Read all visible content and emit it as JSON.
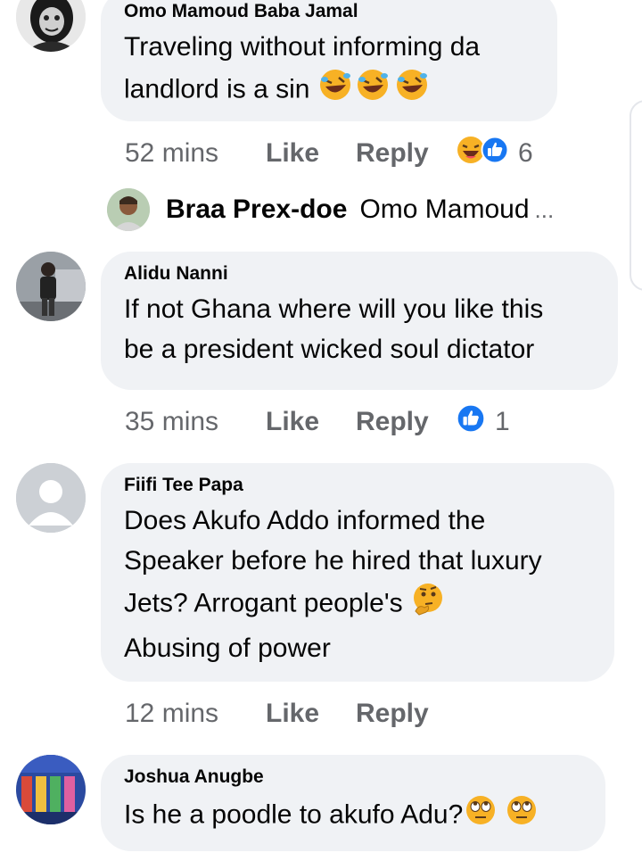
{
  "comments": [
    {
      "author": "Omo Mamoud Baba Jamal",
      "lines": [
        "Traveling without informing da",
        "landlord is a sin"
      ],
      "emoji": "laughing-emoji x3",
      "time": "52 mins",
      "like": "Like",
      "reply": "Reply",
      "reaction_types": [
        "haha",
        "like"
      ],
      "reaction_count": "6"
    },
    {
      "author": "Alidu Nanni",
      "lines": [
        "If not Ghana where will you like this",
        "be a president wicked soul dictator"
      ],
      "time": "35 mins",
      "like": "Like",
      "reply": "Reply",
      "reaction_types": [
        "like"
      ],
      "reaction_count": "1"
    },
    {
      "author": "Fiifi Tee Papa",
      "lines": [
        "Does Akufo Addo informed the",
        "Speaker before he hired that luxury",
        "Jets? Arrogant people's",
        "Abusing of power"
      ],
      "emoji": "thinking-emoji",
      "time": "12 mins",
      "like": "Like",
      "reply": "Reply"
    },
    {
      "author": "Joshua Anugbe",
      "lines": [
        "Is he a poodle to akufo Adu?"
      ],
      "emoji": "eye-roll-emoji x2"
    }
  ],
  "reply_preview": {
    "author": "Braa Prex-doe",
    "snippet": "Omo Mamoud",
    "ellipsis": "..."
  },
  "colors": {
    "bubble": "#f0f2f5",
    "meta_text": "#65676b",
    "like_blue": "#1877f2",
    "emoji_yellow": "#f7b125"
  }
}
